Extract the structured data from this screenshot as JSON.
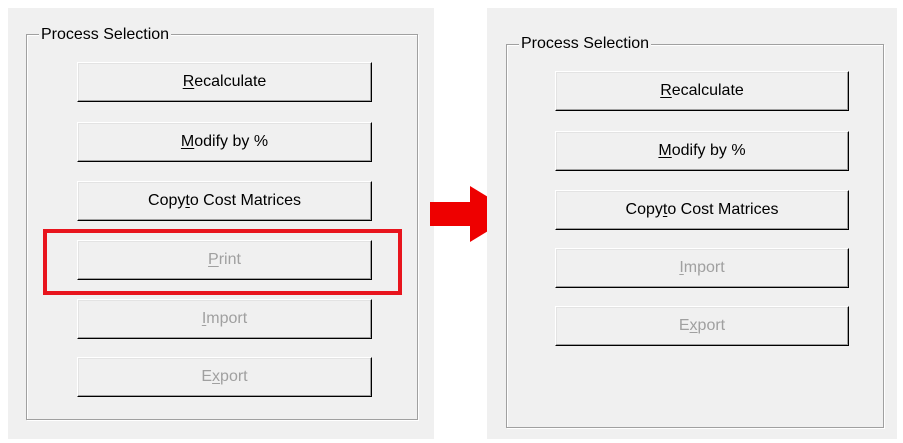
{
  "before": {
    "group_title": "Process Selection",
    "buttons": [
      {
        "pre": "",
        "key": "R",
        "post": "ecalculate",
        "enabled": true
      },
      {
        "pre": "",
        "key": "M",
        "post": "odify by %",
        "enabled": true
      },
      {
        "pre": "Copy ",
        "key": "t",
        "post": "o Cost Matrices",
        "enabled": true
      },
      {
        "pre": "",
        "key": "P",
        "post": "rint",
        "enabled": false
      },
      {
        "pre": "",
        "key": "I",
        "post": "mport",
        "enabled": false
      },
      {
        "pre": "E",
        "key": "x",
        "post": "port",
        "enabled": false
      }
    ]
  },
  "after": {
    "group_title": "Process Selection",
    "buttons": [
      {
        "pre": "",
        "key": "R",
        "post": "ecalculate",
        "enabled": true
      },
      {
        "pre": "",
        "key": "M",
        "post": "odify by %",
        "enabled": true
      },
      {
        "pre": "Copy ",
        "key": "t",
        "post": "o Cost Matrices",
        "enabled": true
      },
      {
        "pre": "",
        "key": "I",
        "post": "mport",
        "enabled": false
      },
      {
        "pre": "E",
        "key": "x",
        "post": "port",
        "enabled": false
      }
    ]
  },
  "colors": {
    "highlight": "#e8141d",
    "arrow": "#ee0000",
    "disabled_text": "#a0a0a0",
    "panel_bg": "#f0f0f0"
  },
  "annotation": {
    "highlighted_button": "Print",
    "arrow_icon": "right-arrow-icon"
  }
}
